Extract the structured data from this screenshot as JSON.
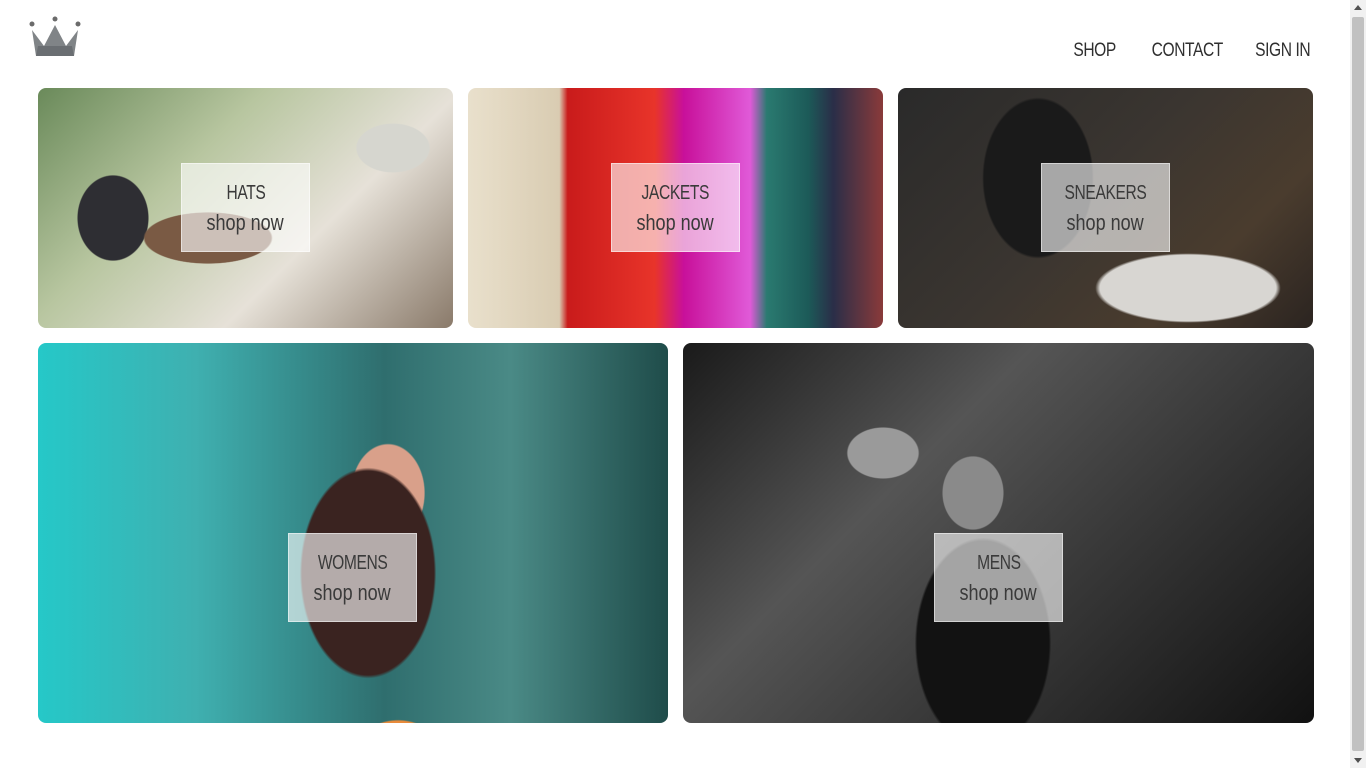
{
  "header": {
    "logo_icon": "crown-icon",
    "nav": {
      "shop": "SHOP",
      "contact": "CONTACT",
      "sign_in": "SIGN IN"
    }
  },
  "directory": {
    "items": [
      {
        "title": "HATS",
        "subtitle": "shop now"
      },
      {
        "title": "JACKETS",
        "subtitle": "shop now"
      },
      {
        "title": "SNEAKERS",
        "subtitle": "shop now"
      },
      {
        "title": "WOMENS",
        "subtitle": "shop now"
      },
      {
        "title": "MENS",
        "subtitle": "shop now"
      }
    ]
  }
}
